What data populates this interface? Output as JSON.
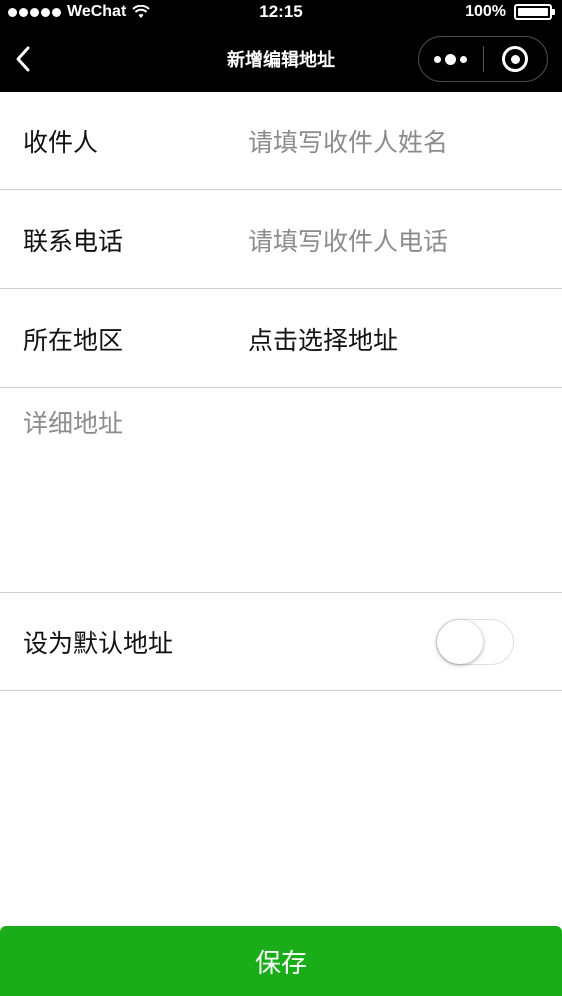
{
  "status_bar": {
    "carrier": "WeChat",
    "time": "12:15",
    "battery_percent": "100%",
    "battery_level": 1.0
  },
  "navbar": {
    "title": "新增编辑地址",
    "back_icon": "chevron-left-icon",
    "more_icon": "more-dots-icon",
    "close_icon": "target-circle-icon"
  },
  "form": {
    "recipient": {
      "label": "收件人",
      "placeholder": "请填写收件人姓名",
      "value": ""
    },
    "phone": {
      "label": "联系电话",
      "placeholder": "请填写收件人电话",
      "value": ""
    },
    "region": {
      "label": "所在地区",
      "value": "点击选择地址"
    },
    "detail": {
      "placeholder": "详细地址",
      "value": ""
    },
    "default_address": {
      "label": "设为默认地址",
      "enabled": false
    }
  },
  "save_button": {
    "label": "保存",
    "color": "#1aad19"
  }
}
